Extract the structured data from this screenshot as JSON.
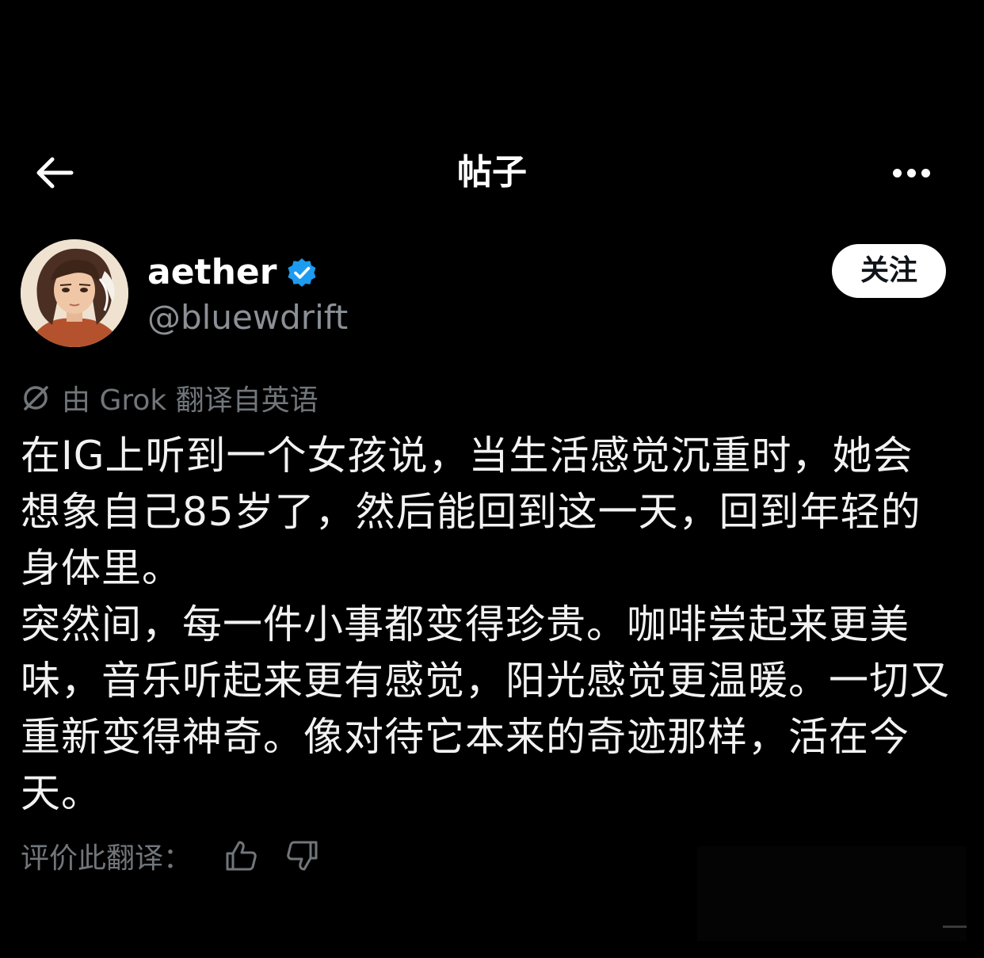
{
  "header": {
    "title": "帖子",
    "back_icon": "arrow-left-icon",
    "more_icon": "more-horizontal-icon"
  },
  "author": {
    "display_name": "aether",
    "handle": "@bluewdrift",
    "verified_icon": "verified-badge-icon",
    "verified_color": "#1d9bf0",
    "follow_label": "关注"
  },
  "translation": {
    "icon": "grok-icon",
    "note": "由 Grok 翻译自英语"
  },
  "post": {
    "paragraph_1": "在IG上听到一个女孩说，当生活感觉沉重时，她会想象自己85岁了，然后能回到这一天，回到年轻的身体里。",
    "paragraph_2": "突然间，每一件小事都变得珍贵。咖啡尝起来更美味，音乐听起来更有感觉，阳光感觉更温暖。一切又重新变得神奇。像对待它本来的奇迹那样，活在今天。"
  },
  "rating": {
    "label": "评价此翻译：",
    "thumbs_up_icon": "thumbs-up-icon",
    "thumbs_down_icon": "thumbs-down-icon"
  }
}
